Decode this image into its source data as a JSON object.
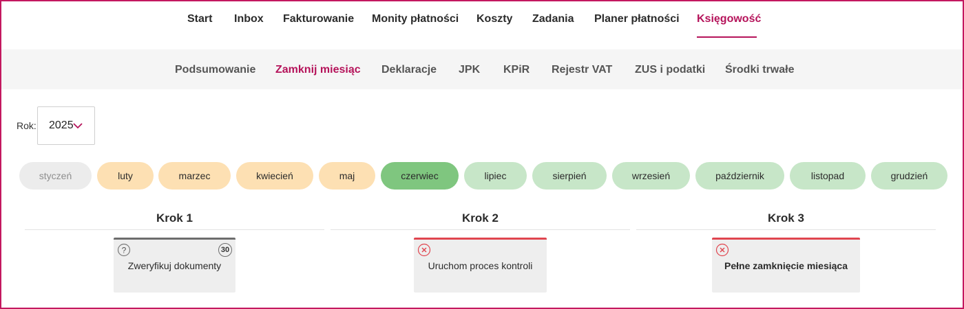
{
  "main_nav": {
    "items": [
      "Start",
      "Inbox",
      "Fakturowanie",
      "Monity płatności",
      "Koszty",
      "Zadania",
      "Planer płatności",
      "Księgowość"
    ],
    "active_index": 7
  },
  "sub_nav": {
    "items": [
      "Podsumowanie",
      "Zamknij miesiąc",
      "Deklaracje",
      "JPK",
      "KPiR",
      "Rejestr VAT",
      "ZUS i podatki",
      "Środki trwałe"
    ],
    "active_index": 1
  },
  "year": {
    "label": "Rok:",
    "value": "2025"
  },
  "months": [
    {
      "name": "styczeń",
      "state": "past"
    },
    {
      "name": "luty",
      "state": "open"
    },
    {
      "name": "marzec",
      "state": "open"
    },
    {
      "name": "kwiecień",
      "state": "open"
    },
    {
      "name": "maj",
      "state": "open"
    },
    {
      "name": "czerwiec",
      "state": "current"
    },
    {
      "name": "lipiec",
      "state": "future"
    },
    {
      "name": "sierpień",
      "state": "future"
    },
    {
      "name": "wrzesień",
      "state": "future"
    },
    {
      "name": "październik",
      "state": "future"
    },
    {
      "name": "listopad",
      "state": "future"
    },
    {
      "name": "grudzień",
      "state": "future"
    }
  ],
  "steps": [
    {
      "title": "Krok 1",
      "card_label": "Zweryfikuj dokumenty",
      "icon": "question-icon",
      "badge": "30",
      "bar_color": "#6d6d6d"
    },
    {
      "title": "Krok 2",
      "card_label": "Uruchom proces kontroli",
      "icon": "error-x-icon",
      "bar_color": "#e0454f"
    },
    {
      "title": "Krok 3",
      "card_label": "Pełne zamknięcie miesiąca",
      "icon": "error-x-icon",
      "bar_color": "#e0454f"
    }
  ],
  "colors": {
    "accent": "#b5135a",
    "month_past": "#ececec",
    "month_open": "#fde0b3",
    "month_current": "#7fc67f",
    "month_future": "#c7e6c8",
    "error": "#e0454f"
  }
}
